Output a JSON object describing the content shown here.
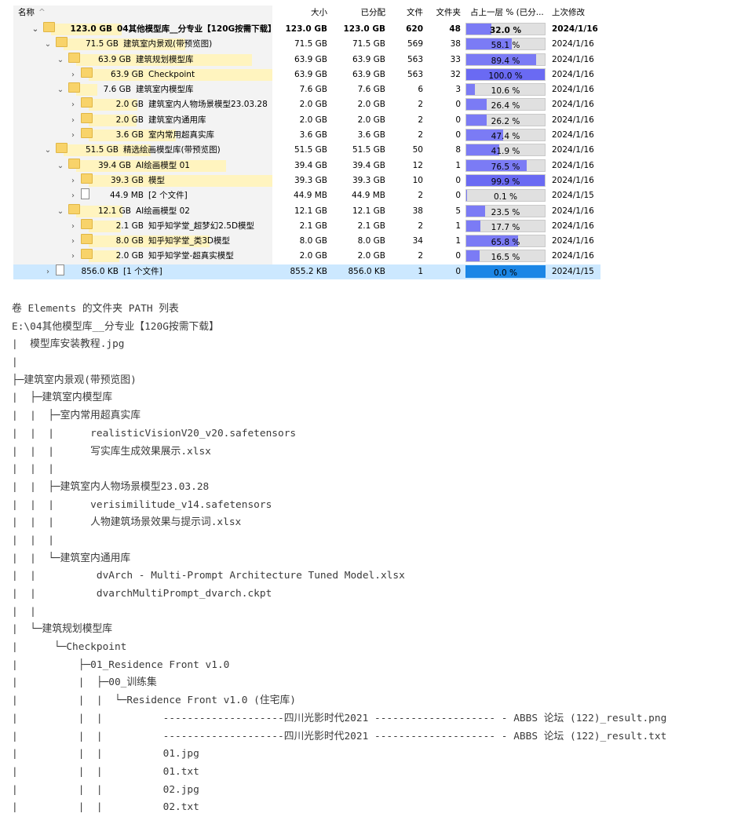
{
  "header": {
    "name": "名称",
    "size": "大小",
    "allocated": "已分配",
    "files": "文件",
    "folders": "文件夹",
    "percent": "占上一层 % (已分...",
    "modified": "上次修改"
  },
  "rows": [
    {
      "indent": 0,
      "expand": "⌄",
      "icon": "folder",
      "size_label": "123.0 GB",
      "name": "04其他模型库__分专业【120G按需下载】",
      "size": "123.0 GB",
      "allocated": "123.0 GB",
      "files": "620",
      "folders": "48",
      "percent": 32.0,
      "percent_label": "32.0 %",
      "date": "2024/1/16",
      "bold": true
    },
    {
      "indent": 1,
      "expand": "⌄",
      "icon": "folder",
      "size_label": "71.5 GB",
      "name": "建筑室内景观(带预览图)",
      "size": "71.5 GB",
      "allocated": "71.5 GB",
      "files": "569",
      "folders": "38",
      "percent": 58.1,
      "percent_label": "58.1 %",
      "date": "2024/1/16"
    },
    {
      "indent": 2,
      "expand": "⌄",
      "icon": "folder",
      "size_label": "63.9 GB",
      "name": "建筑规划模型库",
      "size": "63.9 GB",
      "allocated": "63.9 GB",
      "files": "563",
      "folders": "33",
      "percent": 89.4,
      "percent_label": "89.4 %",
      "date": "2024/1/16"
    },
    {
      "indent": 3,
      "expand": "›",
      "icon": "folder",
      "size_label": "63.9 GB",
      "name": "Checkpoint",
      "size": "63.9 GB",
      "allocated": "63.9 GB",
      "files": "563",
      "folders": "32",
      "percent": 100.0,
      "percent_label": "100.0 %",
      "date": "2024/1/16"
    },
    {
      "indent": 2,
      "expand": "⌄",
      "icon": "folder",
      "size_label": "7.6 GB",
      "name": "建筑室内模型库",
      "size": "7.6 GB",
      "allocated": "7.6 GB",
      "files": "6",
      "folders": "3",
      "percent": 10.6,
      "percent_label": "10.6 %",
      "date": "2024/1/16"
    },
    {
      "indent": 3,
      "expand": "›",
      "icon": "folder",
      "size_label": "2.0 GB",
      "name": "建筑室内人物场景模型23.03.28",
      "size": "2.0 GB",
      "allocated": "2.0 GB",
      "files": "2",
      "folders": "0",
      "percent": 26.4,
      "percent_label": "26.4 %",
      "date": "2024/1/16"
    },
    {
      "indent": 3,
      "expand": "›",
      "icon": "folder",
      "size_label": "2.0 GB",
      "name": "建筑室内通用库",
      "size": "2.0 GB",
      "allocated": "2.0 GB",
      "files": "2",
      "folders": "0",
      "percent": 26.2,
      "percent_label": "26.2 %",
      "date": "2024/1/16"
    },
    {
      "indent": 3,
      "expand": "›",
      "icon": "folder",
      "size_label": "3.6 GB",
      "name": "室内常用超真实库",
      "size": "3.6 GB",
      "allocated": "3.6 GB",
      "files": "2",
      "folders": "0",
      "percent": 47.4,
      "percent_label": "47.4 %",
      "date": "2024/1/16"
    },
    {
      "indent": 1,
      "expand": "⌄",
      "icon": "folder",
      "size_label": "51.5 GB",
      "name": "精选绘画模型库(带预览图)",
      "size": "51.5 GB",
      "allocated": "51.5 GB",
      "files": "50",
      "folders": "8",
      "percent": 41.9,
      "percent_label": "41.9 %",
      "date": "2024/1/16"
    },
    {
      "indent": 2,
      "expand": "⌄",
      "icon": "folder",
      "size_label": "39.4 GB",
      "name": "AI绘画模型 01",
      "size": "39.4 GB",
      "allocated": "39.4 GB",
      "files": "12",
      "folders": "1",
      "percent": 76.5,
      "percent_label": "76.5 %",
      "date": "2024/1/16"
    },
    {
      "indent": 3,
      "expand": "›",
      "icon": "folder",
      "size_label": "39.3 GB",
      "name": "模型",
      "size": "39.3 GB",
      "allocated": "39.3 GB",
      "files": "10",
      "folders": "0",
      "percent": 99.9,
      "percent_label": "99.9 %",
      "date": "2024/1/16"
    },
    {
      "indent": 3,
      "expand": "›",
      "icon": "file",
      "size_label": "44.9 MB",
      "name": "[2 个文件]",
      "size": "44.9 MB",
      "allocated": "44.9 MB",
      "files": "2",
      "folders": "0",
      "percent": 0.1,
      "percent_label": "0.1 %",
      "date": "2024/1/15"
    },
    {
      "indent": 2,
      "expand": "⌄",
      "icon": "folder",
      "size_label": "12.1 GB",
      "name": "AI绘画模型 02",
      "size": "12.1 GB",
      "allocated": "12.1 GB",
      "files": "38",
      "folders": "5",
      "percent": 23.5,
      "percent_label": "23.5 %",
      "date": "2024/1/16"
    },
    {
      "indent": 3,
      "expand": "›",
      "icon": "folder",
      "size_label": "2.1 GB",
      "name": "知乎知学堂_超梦幻2.5D模型",
      "size": "2.1 GB",
      "allocated": "2.1 GB",
      "files": "2",
      "folders": "1",
      "percent": 17.7,
      "percent_label": "17.7 %",
      "date": "2024/1/16"
    },
    {
      "indent": 3,
      "expand": "›",
      "icon": "folder",
      "size_label": "8.0 GB",
      "name": "知乎知学堂_类3D模型",
      "size": "8.0 GB",
      "allocated": "8.0 GB",
      "files": "34",
      "folders": "1",
      "percent": 65.8,
      "percent_label": "65.8 %",
      "date": "2024/1/16"
    },
    {
      "indent": 3,
      "expand": "›",
      "icon": "folder",
      "size_label": "2.0 GB",
      "name": "知乎知学堂-超真实模型",
      "size": "2.0 GB",
      "allocated": "2.0 GB",
      "files": "2",
      "folders": "0",
      "percent": 16.5,
      "percent_label": "16.5 %",
      "date": "2024/1/16"
    },
    {
      "indent": 1,
      "expand": "›",
      "icon": "file",
      "size_label": "856.0 KB",
      "name": "[1 个文件]",
      "size": "855.2 KB",
      "allocated": "856.0 KB",
      "files": "1",
      "folders": "0",
      "percent": 0.0,
      "percent_label": "0.0 %",
      "date": "2024/1/15",
      "selected": true
    }
  ],
  "listing": [
    "卷 Elements 的文件夹 PATH 列表",
    "E:\\04其他模型库__分专业【120G按需下载】",
    "|  模型库安装教程.jpg",
    "|",
    "├─建筑室内景观(带预览图)",
    "|  ├─建筑室内模型库",
    "|  |  ├─室内常用超真实库",
    "|  |  |      realisticVisionV20_v20.safetensors",
    "|  |  |      写实库生成效果展示.xlsx",
    "|  |  |",
    "|  |  ├─建筑室内人物场景模型23.03.28",
    "|  |  |      verisimilitude_v14.safetensors",
    "|  |  |      人物建筑场景效果与提示词.xlsx",
    "|  |  |",
    "|  |  └─建筑室内通用库",
    "|  |          dvArch - Multi-Prompt Architecture Tuned Model.xlsx",
    "|  |          dvarchMultiPrompt_dvarch.ckpt",
    "|  |",
    "|  └─建筑规划模型库",
    "|      └─Checkpoint",
    "|          ├─01_Residence Front v1.0",
    "|          |  ├─00_训练集",
    "|          |  |  └─Residence Front v1.0 (住宅库)",
    "|          |  |          --------------------四川光影时代2021 -------------------- - ABBS 论坛 (122)_result.png",
    "|          |  |          --------------------四川光影时代2021 -------------------- - ABBS 论坛 (122)_result.txt",
    "|          |  |          01.jpg",
    "|          |  |          01.txt",
    "|          |  |          02.jpg",
    "|          |  |          02.txt"
  ]
}
